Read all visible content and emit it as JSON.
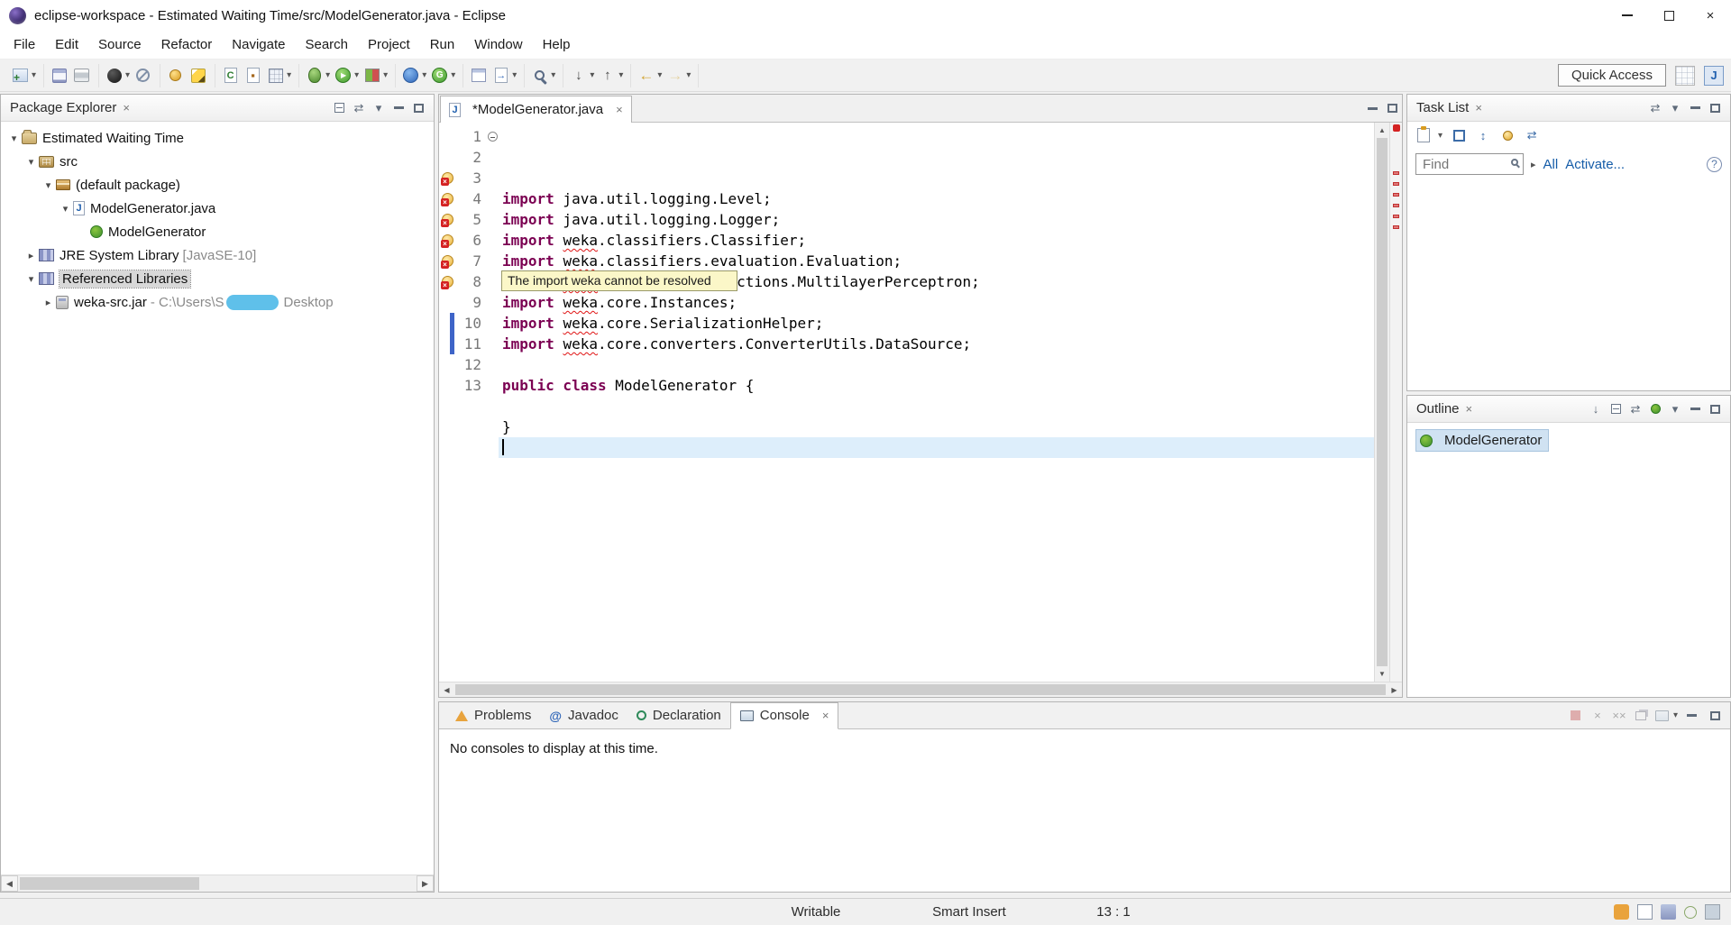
{
  "window": {
    "title": "eclipse-workspace - Estimated Waiting Time/src/ModelGenerator.java - Eclipse"
  },
  "menubar": [
    "File",
    "Edit",
    "Source",
    "Refactor",
    "Navigate",
    "Search",
    "Project",
    "Run",
    "Window",
    "Help"
  ],
  "toolbar": {
    "quick_access": "Quick Access",
    "groups": [
      [
        {
          "icon": "new-wizard",
          "caret": true
        }
      ],
      [
        {
          "icon": "save"
        },
        {
          "icon": "print"
        }
      ],
      [
        {
          "icon": "debug-last",
          "caret": true
        },
        {
          "icon": "skip-breakpoints"
        }
      ],
      [
        {
          "icon": "pin"
        },
        {
          "icon": "mark-pencil"
        }
      ],
      [
        {
          "icon": "new-class"
        },
        {
          "icon": "new-package"
        },
        {
          "icon": "open-type",
          "caret": true
        }
      ],
      [
        {
          "icon": "debug",
          "caret": true
        },
        {
          "icon": "run",
          "caret": true
        },
        {
          "icon": "coverage",
          "caret": true
        }
      ],
      [
        {
          "icon": "profile",
          "caret": true
        },
        {
          "icon": "external-g",
          "caret": true
        }
      ],
      [
        {
          "icon": "table"
        },
        {
          "icon": "open-task",
          "caret": true
        }
      ],
      [
        {
          "icon": "search",
          "caret": true
        }
      ],
      [
        {
          "icon": "next-annotation",
          "caret": true
        },
        {
          "icon": "prev-annotation",
          "caret": true
        }
      ],
      [
        {
          "icon": "back",
          "caret": true
        },
        {
          "icon": "forward",
          "caret": true,
          "dim": true
        }
      ]
    ]
  },
  "package_explorer": {
    "title": "Package Explorer",
    "tree": [
      {
        "level": 0,
        "exp": true,
        "icon": "project",
        "label": "Estimated Waiting Time"
      },
      {
        "level": 1,
        "exp": true,
        "icon": "src-folder",
        "label": "src"
      },
      {
        "level": 2,
        "exp": true,
        "icon": "package",
        "label": "(default package)"
      },
      {
        "level": 3,
        "exp": true,
        "icon": "java-file",
        "label": "ModelGenerator.java"
      },
      {
        "level": 4,
        "icon": "class",
        "label": "ModelGenerator"
      },
      {
        "level": 1,
        "exp": false,
        "icon": "library",
        "label": "JRE System Library",
        "suffix": " [JavaSE-10]"
      },
      {
        "level": 1,
        "exp": true,
        "icon": "library",
        "label": "Referenced Libraries",
        "selected": true
      },
      {
        "level": 2,
        "exp": false,
        "icon": "jar",
        "label": "weka-src.jar",
        "suffix": " - C:\\Users\\S",
        "censor": true,
        "suffix2": "Desktop"
      }
    ]
  },
  "editor": {
    "tab_label": "*ModelGenerator.java",
    "tooltip": "The import weka cannot be resolved",
    "lines": [
      {
        "n": 1,
        "fold": "minus",
        "seg": [
          [
            "kw",
            "import"
          ],
          [
            "pl",
            " java.util.logging.Level;"
          ]
        ]
      },
      {
        "n": 2,
        "seg": [
          [
            "kw",
            "import"
          ],
          [
            "pl",
            " java.util.logging.Logger;"
          ]
        ]
      },
      {
        "n": 3,
        "err": true,
        "seg": [
          [
            "kw",
            "import"
          ],
          [
            "pl",
            " "
          ],
          [
            "er",
            "weka"
          ],
          [
            "pl",
            ".classifiers.Classifier;"
          ]
        ]
      },
      {
        "n": 4,
        "err": true,
        "seg": [
          [
            "kw",
            "import"
          ],
          [
            "pl",
            " "
          ],
          [
            "er",
            "weka"
          ],
          [
            "pl",
            ".classifiers.evaluation.Evaluation;"
          ]
        ]
      },
      {
        "n": 5,
        "err": true,
        "seg": [
          [
            "kw",
            "import"
          ],
          [
            "pl",
            " "
          ],
          [
            "er",
            "weka"
          ],
          [
            "pl",
            ".classifiers.functions.MultilayerPerceptron;"
          ]
        ]
      },
      {
        "n": 6,
        "err": true,
        "seg": [
          [
            "kw",
            "import"
          ],
          [
            "pl",
            " "
          ],
          [
            "er",
            "weka"
          ],
          [
            "pl",
            ".core.Instances;"
          ]
        ]
      },
      {
        "n": 7,
        "err": true,
        "seg": [
          [
            "kw",
            "import"
          ],
          [
            "pl",
            " "
          ],
          [
            "er",
            "weka"
          ],
          [
            "pl",
            ".core.SerializationHelper;"
          ]
        ]
      },
      {
        "n": 8,
        "err": true,
        "seg": [
          [
            "kw",
            "import"
          ],
          [
            "pl",
            " "
          ],
          [
            "er",
            "weka"
          ],
          [
            "pl",
            ".core.converters.ConverterUtils.DataSource;"
          ]
        ]
      },
      {
        "n": 9,
        "seg": []
      },
      {
        "n": 10,
        "seg": [
          [
            "kw",
            "public class"
          ],
          [
            "pl",
            " ModelGenerator {"
          ]
        ]
      },
      {
        "n": 11,
        "seg": []
      },
      {
        "n": 12,
        "seg": [
          [
            "pl",
            "}"
          ]
        ]
      },
      {
        "n": 13,
        "current": true,
        "caret": true,
        "seg": []
      }
    ]
  },
  "task_list": {
    "title": "Task List",
    "find_placeholder": "Find",
    "link_all": "All",
    "link_activate": "Activate..."
  },
  "outline": {
    "title": "Outline",
    "items": [
      {
        "label": "ModelGenerator",
        "icon": "class",
        "selected": true
      }
    ]
  },
  "console": {
    "tabs": [
      {
        "label": "Problems",
        "icon": "problems"
      },
      {
        "label": "Javadoc",
        "icon": "javadoc"
      },
      {
        "label": "Declaration",
        "icon": "declaration"
      },
      {
        "label": "Console",
        "icon": "console",
        "active": true,
        "closable": true
      }
    ],
    "message": "No consoles to display at this time."
  },
  "statusbar": {
    "writable": "Writable",
    "insert_mode": "Smart Insert",
    "position": "13 : 1"
  },
  "colors": {
    "keyword": "#7b0052",
    "error_underline": "#e01414",
    "current_line": "#ddeefb",
    "selection_inactive": "#d8d8d8",
    "selection_outline": "#d0e2f2",
    "tooltip_bg": "#fbf7c8",
    "link": "#155ca8",
    "censor_blob": "#5fc0ea"
  }
}
